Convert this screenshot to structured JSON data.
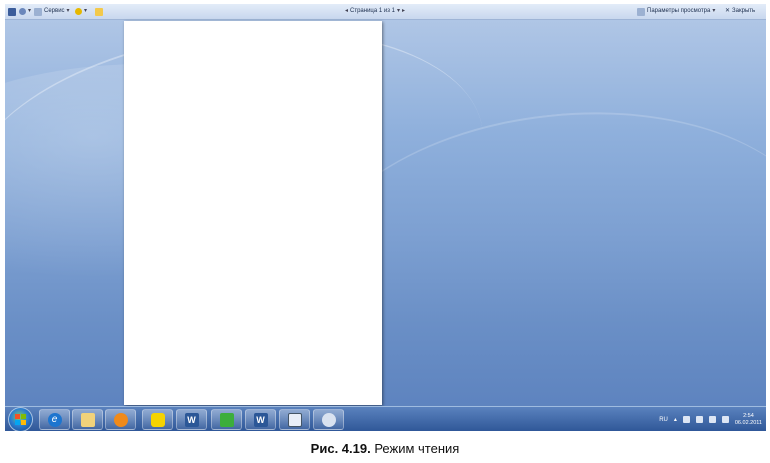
{
  "toolbar": {
    "service_label": "Сервис",
    "page_indicator": "Страница 1 из 1",
    "view_options_label": "Параметры просмотра",
    "close_label": "Закрыть"
  },
  "taskbar": {
    "language": "RU",
    "time": "2:54",
    "date": "06.02.2011",
    "word_letter": "W"
  },
  "caption": {
    "figure": "Рис. 4.19.",
    "text": "Режим чтения"
  },
  "icons": {
    "toolbar": [
      "save-icon",
      "find-icon",
      "tools-icon",
      "help-icon",
      "folder-icon"
    ],
    "taskbar": [
      "internet-explorer-icon",
      "explorer-icon",
      "media-player-icon",
      "batman-icon",
      "word-icon",
      "network-icon",
      "word-icon",
      "notepad-icon",
      "paint-icon"
    ]
  }
}
